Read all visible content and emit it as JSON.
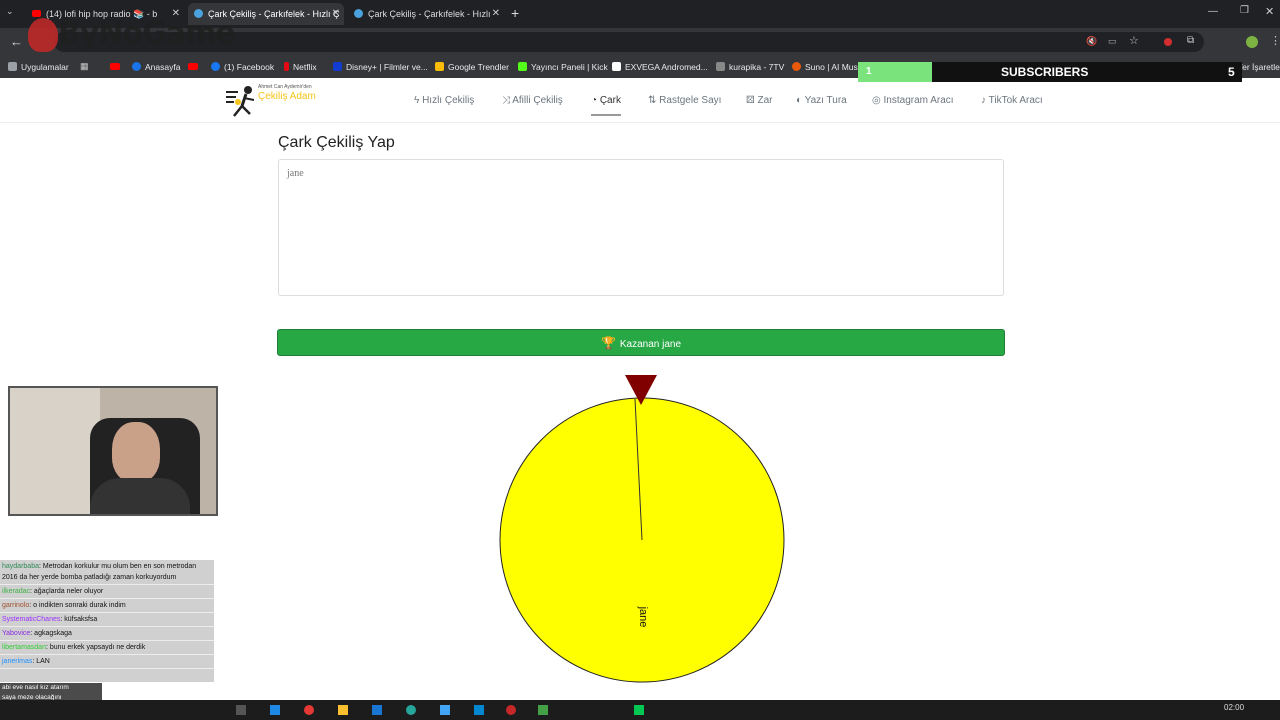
{
  "browser": {
    "tabs": [
      {
        "label": "(14) lofi hip hop radio 📚 - b"
      },
      {
        "label": "Çark Çekiliş - Çarkıfelek - Hızlı Ç"
      },
      {
        "label": "Çark Çekiliş - Çarkıfelek - Hızlı"
      }
    ],
    "bookmarks": [
      {
        "label": "Uygulamalar",
        "color": "#9aa0a6"
      },
      {
        "label": "Anasayfa",
        "color": "#1a73e8"
      },
      {
        "label": "(1) Facebook",
        "color": "#1877f2"
      },
      {
        "label": "Netflix",
        "color": "#e50914"
      },
      {
        "label": "Disney+ | Filmler ve...",
        "color": "#113ccf"
      },
      {
        "label": "Google Trendler",
        "color": "#fbbc05"
      },
      {
        "label": "Yayıncı Paneli | Kick",
        "color": "#53fc18"
      },
      {
        "label": "EXVEGA Andromed...",
        "color": "#ffffff"
      },
      {
        "label": "kurapika - 7TV",
        "color": "#888888"
      },
      {
        "label": "Suno | AI Mus",
        "color": "#e8590c"
      }
    ],
    "other_bookmarks": "Tüm Yer İşaretler"
  },
  "site": {
    "logo_caption": "Ahmet Can Aydemir'den",
    "logo_title": "Çekiliş Adam",
    "nav": [
      {
        "label": "Hızlı Çekiliş",
        "icon": "bolt-icon"
      },
      {
        "label": "Afilli Çekiliş",
        "icon": "shuffle-icon"
      },
      {
        "label": "Çark",
        "icon": "pie-chart-icon"
      },
      {
        "label": "Rastgele Sayı",
        "icon": "sort-icon"
      },
      {
        "label": "Zar",
        "icon": "dice-icon"
      },
      {
        "label": "Yazı Tura",
        "icon": "coin-icon"
      },
      {
        "label": "Instagram Aracı",
        "icon": "instagram-icon"
      },
      {
        "label": "TikTok Aracı",
        "icon": "tiktok-icon"
      }
    ],
    "active_nav": "Çark",
    "page_title": "Çark Çekiliş Yap",
    "names_value": "jane",
    "winner_button": "Kazanan jane",
    "wheel": {
      "segment_label": "jane",
      "fill": "#ffff00",
      "pointer_color": "#800000"
    }
  },
  "overlay": {
    "watermark": "ByNoGame",
    "subscribers_count": "1",
    "subscribers_label": "SUBSCRIBERS",
    "subscribers_goal": "5",
    "chat": [
      {
        "user": "haydarbaba",
        "msg": ": Metrodan korkulur mu olum ben en son metrodan 2016 da her yerde bomba patladığı zaman korkuyordum",
        "color": "#2e8b57"
      },
      {
        "user": "ilkeradac",
        "msg": ": ağaçlarda neler oluyor",
        "color": "#3cb043"
      },
      {
        "user": "garrinolo",
        "msg": ": o indikten sonraki durak indim",
        "color": "#a0522d"
      },
      {
        "user": "SystematicChanes",
        "msg": ": küfsaksfsa",
        "color": "#9b30ff"
      },
      {
        "user": "Yabovice",
        "msg": ": agkagskaga",
        "color": "#8a2be2"
      },
      {
        "user": "libertamasdan",
        "msg": ": bunu erkek yapsaydı ne derdik",
        "color": "#32cd32"
      },
      {
        "user": "janerimas",
        "msg": ": LAN",
        "color": "#1e90ff"
      }
    ],
    "ticker": [
      "abi eve nasıl kız atarım",
      "saya meze olacağını"
    ],
    "clock": "02:00"
  }
}
